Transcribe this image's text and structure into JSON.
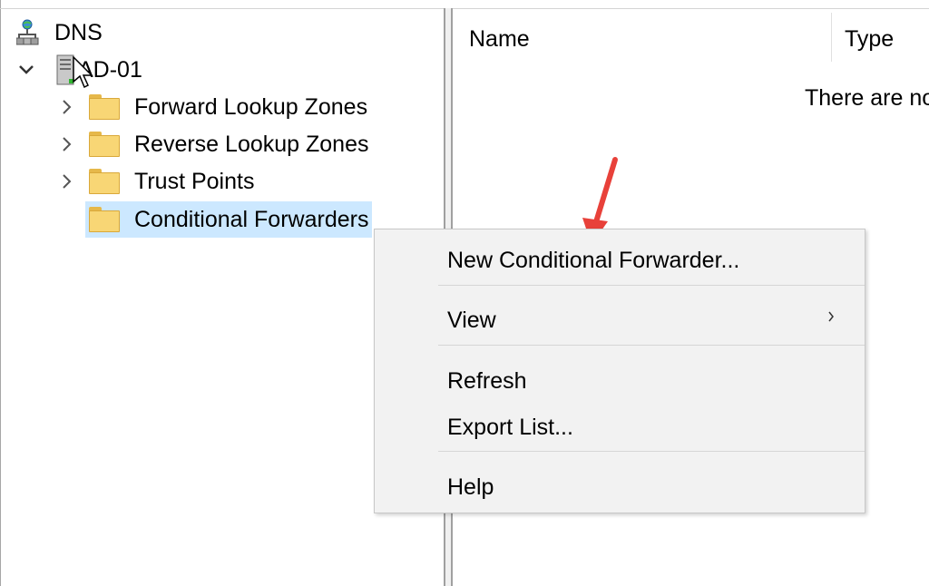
{
  "tree": {
    "root_label": "DNS",
    "server_label": "AD-01",
    "items": [
      {
        "label": "Forward Lookup Zones",
        "expandable": true
      },
      {
        "label": "Reverse Lookup Zones",
        "expandable": true
      },
      {
        "label": "Trust Points",
        "expandable": true
      },
      {
        "label": "Conditional Forwarders",
        "expandable": false,
        "selected": true
      }
    ]
  },
  "list": {
    "columns": [
      "Name",
      "Type"
    ],
    "empty_message": "There are no"
  },
  "context_menu": {
    "items": [
      {
        "label": "New Conditional Forwarder..."
      },
      {
        "label": "View",
        "submenu": true
      },
      {
        "label": "Refresh"
      },
      {
        "label": "Export List..."
      },
      {
        "label": "Help"
      }
    ]
  },
  "colors": {
    "selection": "#cce8ff",
    "menu_bg": "#f2f2f2",
    "folder": "#f8d675",
    "annotation_arrow": "#e8413a"
  },
  "icons": {
    "root": "dns-network-icon",
    "server": "server-icon",
    "folder": "folder-icon",
    "expand": "chevron-right-icon",
    "collapse": "chevron-down-icon",
    "submenu": "chevron-right-icon"
  }
}
